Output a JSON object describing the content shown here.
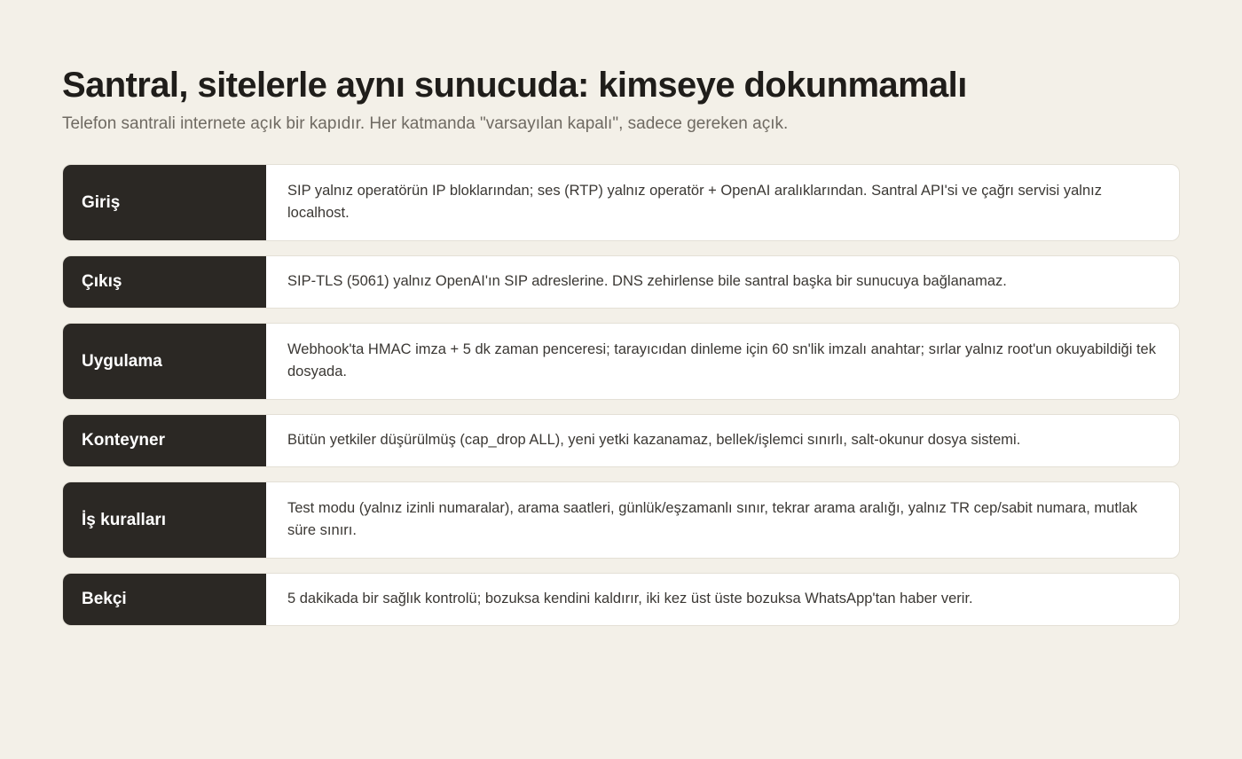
{
  "header": {
    "title": "Santral, sitelerle aynı sunucuda: kimseye dokunmamalı",
    "subtitle": "Telefon santrali internete açık bir kapıdır. Her katmanda \"varsayılan kapalı\", sadece gereken açık."
  },
  "rows": [
    {
      "label": "Giriş",
      "desc": "SIP yalnız operatörün IP bloklarından; ses (RTP) yalnız operatör + OpenAI aralıklarından. Santral API'si ve çağrı servisi yalnız localhost."
    },
    {
      "label": "Çıkış",
      "desc": "SIP-TLS (5061) yalnız OpenAI'ın SIP adreslerine. DNS zehirlense bile santral başka bir sunucuya bağlanamaz."
    },
    {
      "label": "Uygulama",
      "desc": "Webhook'ta HMAC imza + 5 dk zaman penceresi; tarayıcıdan dinleme için 60 sn'lik imzalı anahtar; sırlar yalnız root'un okuyabildiği tek dosyada."
    },
    {
      "label": "Konteyner",
      "desc": "Bütün yetkiler düşürülmüş (cap_drop ALL), yeni yetki kazanamaz, bellek/işlemci sınırlı, salt-okunur dosya sistemi."
    },
    {
      "label": "İş kuralları",
      "desc": "Test modu (yalnız izinli numaralar), arama saatleri, günlük/eşzamanlı sınır, tekrar arama aralığı, yalnız TR cep/sabit numara, mutlak süre sınırı."
    },
    {
      "label": "Bekçi",
      "desc": "5 dakikada bir sağlık kontrolü; bozuksa kendini kaldırır, iki kez üst üste bozuksa WhatsApp'tan haber verir."
    }
  ]
}
